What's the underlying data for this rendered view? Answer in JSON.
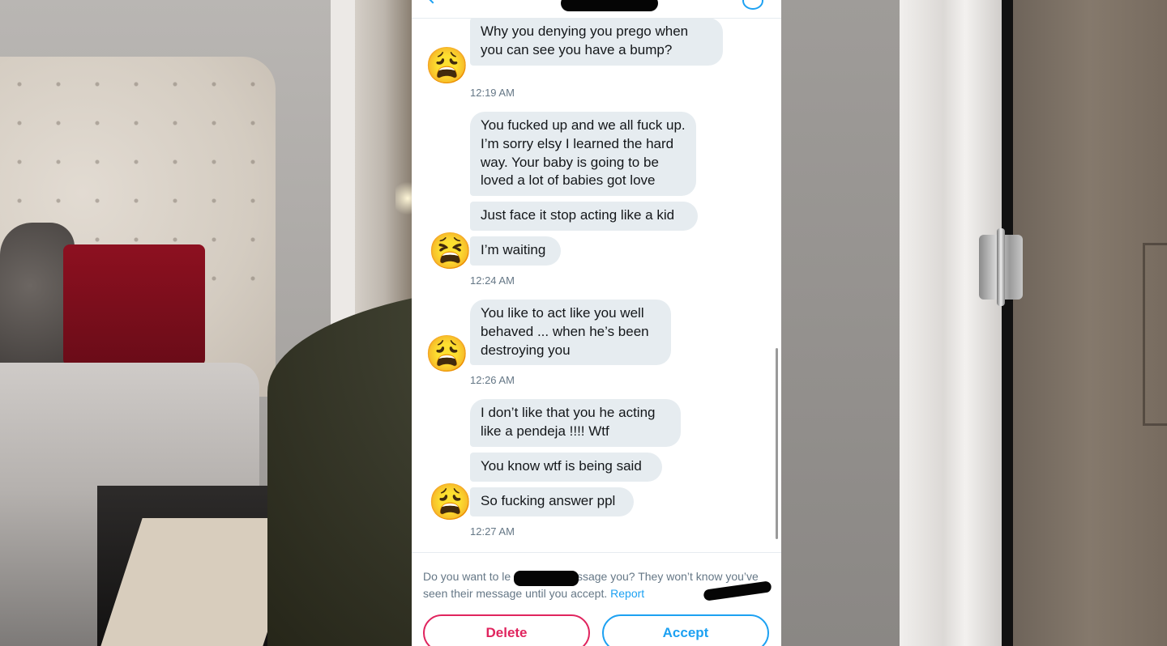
{
  "conversation": {
    "messages": [
      {
        "text": "Why you denying you prego when you can see you have a bump?"
      },
      {
        "text": "You fucked up and we all fuck up. I’m sorry elsy I learned the hard way. Your baby is going to be loved a lot of babies got love"
      },
      {
        "text": "Just face it stop acting like a kid"
      },
      {
        "text": "I’m waiting"
      },
      {
        "text": "You like to act like you well behaved ... when he’s been destroying you"
      },
      {
        "text": "I don’t like that you he acting like a pendeja !!!! Wtf"
      },
      {
        "text": "You know wtf is being said"
      },
      {
        "text": "So fucking answer ppl"
      }
    ],
    "timestamps": [
      "12:19 AM",
      "12:24 AM",
      "12:26 AM",
      "12:27 AM"
    ],
    "avatars": [
      "😩",
      "😫",
      "😩",
      "😩"
    ]
  },
  "request_notice": {
    "part1": "Do you want to le",
    "part2": "essage you? They won’t know you’ve seen their message until you accept.",
    "report_label": "Report"
  },
  "actions": {
    "delete_label": "Delete",
    "accept_label": "Accept"
  },
  "colors": {
    "accent": "#1da1f2",
    "danger": "#e0245e",
    "bubble": "#e6ecf0",
    "meta_text": "#657786"
  }
}
